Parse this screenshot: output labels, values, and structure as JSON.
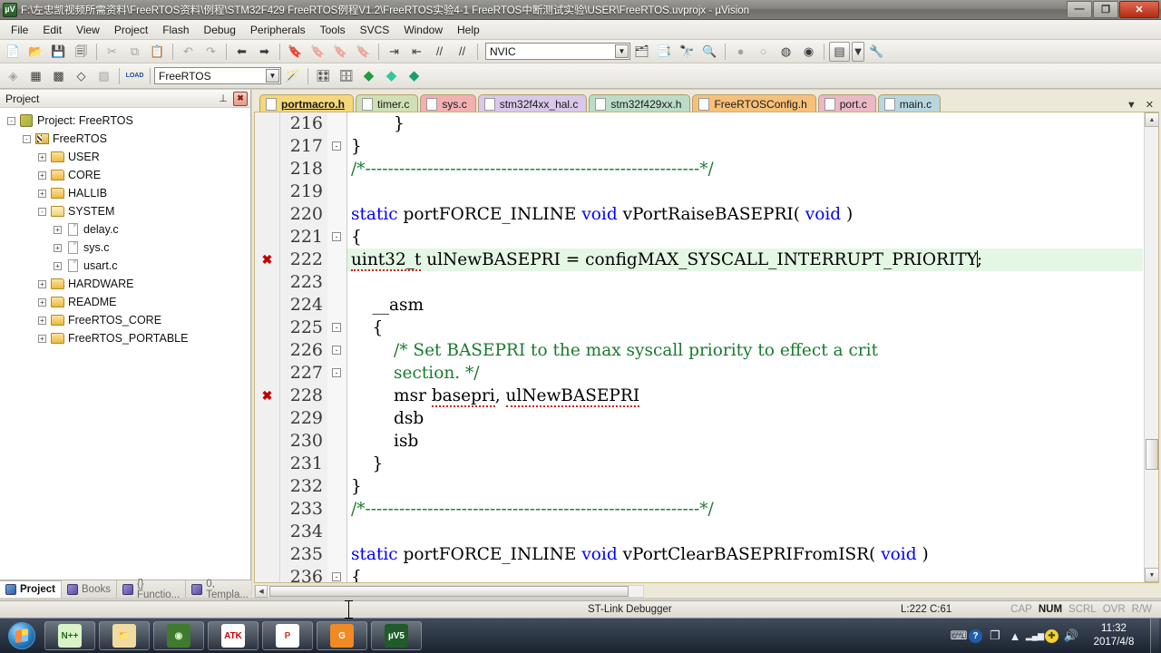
{
  "window": {
    "title": "F:\\左忠凯视频所需资料\\FreeRTOS资料\\例程\\STM32F429 FreeRTOS例程V1.2\\FreeRTOS实验4-1 FreeRTOS中断测试实验\\USER\\FreeRTOS.uvprojx - µVision",
    "app_icon_label": "µV",
    "minimize": "—",
    "restore": "❐",
    "close": "✕"
  },
  "menu": {
    "items": [
      "File",
      "Edit",
      "View",
      "Project",
      "Flash",
      "Debug",
      "Peripherals",
      "Tools",
      "SVCS",
      "Window",
      "Help"
    ]
  },
  "toolbar1": {
    "buttons": [
      {
        "name": "new-file",
        "glyph": "📄",
        "enabled": true
      },
      {
        "name": "open-file",
        "glyph": "📂",
        "enabled": true
      },
      {
        "name": "save",
        "glyph": "💾",
        "enabled": true
      },
      {
        "name": "save-all",
        "glyph": "🗐",
        "enabled": true
      },
      {
        "name": "cut",
        "glyph": "✂",
        "enabled": false
      },
      {
        "name": "copy",
        "glyph": "⧉",
        "enabled": false
      },
      {
        "name": "paste",
        "glyph": "📋",
        "enabled": true
      },
      {
        "name": "undo",
        "glyph": "↶",
        "enabled": false
      },
      {
        "name": "redo",
        "glyph": "↷",
        "enabled": false
      },
      {
        "name": "navigate-back",
        "glyph": "⬅",
        "enabled": true
      },
      {
        "name": "navigate-forward",
        "glyph": "➡",
        "enabled": true
      },
      {
        "name": "insert-bookmark",
        "glyph": "🔖",
        "enabled": true
      },
      {
        "name": "prev-bookmark",
        "glyph": "🔖",
        "enabled": false
      },
      {
        "name": "next-bookmark",
        "glyph": "🔖",
        "enabled": false
      },
      {
        "name": "clear-bookmarks",
        "glyph": "🔖",
        "enabled": false
      },
      {
        "name": "indent",
        "glyph": "⇥",
        "enabled": true
      },
      {
        "name": "outdent",
        "glyph": "⇤",
        "enabled": true
      },
      {
        "name": "comment-lines",
        "glyph": "//",
        "enabled": true
      },
      {
        "name": "uncomment-lines",
        "glyph": "//",
        "enabled": true
      }
    ],
    "symbol_combo_value": "NVIC",
    "symbol_combo_placeholder": "",
    "right_buttons": [
      {
        "name": "open-symbol",
        "glyph": "🗂",
        "enabled": true
      },
      {
        "name": "browse-info",
        "glyph": "📑",
        "enabled": true
      },
      {
        "name": "find-in-files",
        "glyph": "🔭",
        "enabled": true
      },
      {
        "name": "find-replace",
        "glyph": "🔍",
        "enabled": true
      },
      {
        "name": "insert-breakpoint",
        "glyph": "●",
        "enabled": false
      },
      {
        "name": "disable-breakpoint",
        "glyph": "○",
        "enabled": false
      },
      {
        "name": "disable-all-breakpoints",
        "glyph": "◍",
        "enabled": true
      },
      {
        "name": "kill-all-breakpoints",
        "glyph": "◉",
        "enabled": true
      },
      {
        "name": "manage-windows",
        "glyph": "▤",
        "enabled": true
      },
      {
        "name": "configuration-wizard",
        "glyph": "🔧",
        "enabled": true
      }
    ]
  },
  "toolbar2": {
    "buttons": [
      {
        "name": "translate-file",
        "glyph": "◈",
        "enabled": false
      },
      {
        "name": "build-target",
        "glyph": "▦",
        "enabled": true
      },
      {
        "name": "rebuild-all",
        "glyph": "▩",
        "enabled": true
      },
      {
        "name": "batch-build",
        "glyph": "◇",
        "enabled": true
      },
      {
        "name": "stop-build",
        "glyph": "▨",
        "enabled": false
      },
      {
        "name": "download-to-flash",
        "glyph": "LOAD",
        "enabled": true
      }
    ],
    "target_combo_value": "FreeRTOS",
    "right_buttons": [
      {
        "name": "target-options-magic-wand",
        "glyph": "🪄",
        "enabled": true
      },
      {
        "name": "options-for-target",
        "glyph": "🎛",
        "enabled": true
      },
      {
        "name": "manage-project-items",
        "glyph": "🗄",
        "enabled": true
      },
      {
        "name": "multi-project-green",
        "glyph": "◆",
        "enabled": true
      },
      {
        "name": "multi-project-teal",
        "glyph": "◆",
        "enabled": true
      },
      {
        "name": "pack-installer",
        "glyph": "◆",
        "enabled": true
      }
    ]
  },
  "project_panel": {
    "title": "Project",
    "pin_glyph": "⊥",
    "close_glyph": "✖",
    "tree": [
      {
        "depth": 0,
        "expander": "-",
        "icon": "project-root-icon",
        "label": "Project: FreeRTOS"
      },
      {
        "depth": 1,
        "expander": "-",
        "icon": "target-icon",
        "label": "FreeRTOS"
      },
      {
        "depth": 2,
        "expander": "+",
        "icon": "folder-icon",
        "label": "USER"
      },
      {
        "depth": 2,
        "expander": "+",
        "icon": "folder-icon",
        "label": "CORE"
      },
      {
        "depth": 2,
        "expander": "+",
        "icon": "folder-icon",
        "label": "HALLIB"
      },
      {
        "depth": 2,
        "expander": "-",
        "icon": "folder-open-icon",
        "label": "SYSTEM"
      },
      {
        "depth": 3,
        "expander": "+",
        "icon": "file-icon",
        "label": "delay.c"
      },
      {
        "depth": 3,
        "expander": "+",
        "icon": "file-icon",
        "label": "sys.c"
      },
      {
        "depth": 3,
        "expander": "+",
        "icon": "file-icon",
        "label": "usart.c"
      },
      {
        "depth": 2,
        "expander": "+",
        "icon": "folder-icon",
        "label": "HARDWARE"
      },
      {
        "depth": 2,
        "expander": "+",
        "icon": "folder-icon",
        "label": "README"
      },
      {
        "depth": 2,
        "expander": "+",
        "icon": "folder-icon",
        "label": "FreeRTOS_CORE"
      },
      {
        "depth": 2,
        "expander": "+",
        "icon": "folder-icon",
        "label": "FreeRTOS_PORTABLE"
      }
    ],
    "bottom_tabs": [
      {
        "label": "Project",
        "icon": "project-tab-icon",
        "active": true
      },
      {
        "label": "Books",
        "icon": "books-tab-icon",
        "active": false
      },
      {
        "label": "{} Functio...",
        "icon": "functions-tab-icon",
        "active": false
      },
      {
        "label": "0, Templa...",
        "icon": "templates-tab-icon",
        "active": false
      }
    ]
  },
  "editor": {
    "tabs": [
      {
        "label": "portmacro.h",
        "color": "#f6d87a",
        "active": true
      },
      {
        "label": "timer.c",
        "color": "#cfe0b4",
        "active": false
      },
      {
        "label": "sys.c",
        "color": "#f2b0b0",
        "active": false
      },
      {
        "label": "stm32f4xx_hal.c",
        "color": "#d9c8ea",
        "active": false
      },
      {
        "label": "stm32f429xx.h",
        "color": "#bcdcc8",
        "active": false
      },
      {
        "label": "FreeRTOSConfig.h",
        "color": "#f7c079",
        "active": false
      },
      {
        "label": "port.c",
        "color": "#eab8c6",
        "active": false
      },
      {
        "label": "main.c",
        "color": "#b9d6de",
        "active": false
      }
    ],
    "tab_dropdown_glyph": "▼",
    "tab_close_glyph": "✕",
    "lines": [
      {
        "num": "216",
        "fold": "",
        "mark": "",
        "highlight": false,
        "segments": [
          {
            "t": "        }",
            "c": "plain"
          }
        ]
      },
      {
        "num": "217",
        "fold": "-",
        "mark": "",
        "highlight": false,
        "segments": [
          {
            "t": "}",
            "c": "plain"
          }
        ]
      },
      {
        "num": "218",
        "fold": "",
        "mark": "",
        "highlight": false,
        "segments": [
          {
            "t": "/*-----------------------------------------------------------*/",
            "c": "cmt"
          }
        ]
      },
      {
        "num": "219",
        "fold": "",
        "mark": "",
        "highlight": false,
        "segments": []
      },
      {
        "num": "220",
        "fold": "",
        "mark": "",
        "highlight": false,
        "segments": [
          {
            "t": "static",
            "c": "kw"
          },
          {
            "t": " portFORCE_INLINE ",
            "c": "plain"
          },
          {
            "t": "void",
            "c": "kw"
          },
          {
            "t": " vPortRaiseBASEPRI( ",
            "c": "plain"
          },
          {
            "t": "void",
            "c": "kw"
          },
          {
            "t": " )",
            "c": "plain"
          }
        ]
      },
      {
        "num": "221",
        "fold": "-",
        "mark": "",
        "highlight": false,
        "segments": [
          {
            "t": "{",
            "c": "plain"
          }
        ]
      },
      {
        "num": "222",
        "fold": "",
        "mark": "✖",
        "highlight": true,
        "segments": [
          {
            "t": "uint32_t",
            "c": "squiggle"
          },
          {
            "t": " ulNewBASEPRI = configMAX_SYSCALL_INTERRUPT_PRIORITY",
            "c": "plain"
          },
          {
            "t": "|",
            "c": "caret"
          },
          {
            "t": ";",
            "c": "plain"
          }
        ]
      },
      {
        "num": "223",
        "fold": "",
        "mark": "",
        "highlight": false,
        "segments": []
      },
      {
        "num": "224",
        "fold": "",
        "mark": "",
        "highlight": false,
        "segments": [
          {
            "t": "    __asm",
            "c": "plain"
          }
        ]
      },
      {
        "num": "225",
        "fold": "-",
        "mark": "",
        "highlight": false,
        "segments": [
          {
            "t": "    {",
            "c": "plain"
          }
        ]
      },
      {
        "num": "226",
        "fold": "-",
        "mark": "",
        "highlight": false,
        "segments": [
          {
            "t": "        /* Set BASEPRI to the max syscall priority to effect a crit",
            "c": "cmt"
          }
        ]
      },
      {
        "num": "227",
        "fold": "-",
        "mark": "",
        "highlight": false,
        "segments": [
          {
            "t": "        section. */",
            "c": "cmt"
          }
        ]
      },
      {
        "num": "228",
        "fold": "",
        "mark": "✖",
        "highlight": false,
        "segments": [
          {
            "t": "        msr ",
            "c": "plain"
          },
          {
            "t": "basepri",
            "c": "squiggle"
          },
          {
            "t": ", ",
            "c": "plain"
          },
          {
            "t": "ulNewBASEPRI",
            "c": "squiggle"
          }
        ]
      },
      {
        "num": "229",
        "fold": "",
        "mark": "",
        "highlight": false,
        "segments": [
          {
            "t": "        dsb",
            "c": "plain"
          }
        ]
      },
      {
        "num": "230",
        "fold": "",
        "mark": "",
        "highlight": false,
        "segments": [
          {
            "t": "        isb",
            "c": "plain"
          }
        ]
      },
      {
        "num": "231",
        "fold": "",
        "mark": "",
        "highlight": false,
        "segments": [
          {
            "t": "    }",
            "c": "plain"
          }
        ]
      },
      {
        "num": "232",
        "fold": "",
        "mark": "",
        "highlight": false,
        "segments": [
          {
            "t": "}",
            "c": "plain"
          }
        ]
      },
      {
        "num": "233",
        "fold": "",
        "mark": "",
        "highlight": false,
        "segments": [
          {
            "t": "/*-----------------------------------------------------------*/",
            "c": "cmt"
          }
        ]
      },
      {
        "num": "234",
        "fold": "",
        "mark": "",
        "highlight": false,
        "segments": []
      },
      {
        "num": "235",
        "fold": "",
        "mark": "",
        "highlight": false,
        "segments": [
          {
            "t": "static",
            "c": "kw"
          },
          {
            "t": " portFORCE_INLINE ",
            "c": "plain"
          },
          {
            "t": "void",
            "c": "kw"
          },
          {
            "t": " vPortClearBASEPRIFromISR( ",
            "c": "plain"
          },
          {
            "t": "void",
            "c": "kw"
          },
          {
            "t": " )",
            "c": "plain"
          }
        ]
      },
      {
        "num": "236",
        "fold": "-",
        "mark": "",
        "highlight": false,
        "segments": [
          {
            "t": "{",
            "c": "plain"
          }
        ]
      }
    ],
    "scroll_up_glyph": "▲",
    "scroll_down_glyph": "▼",
    "scroll_left_glyph": "◀",
    "scroll_right_glyph": "▶"
  },
  "statusbar": {
    "debugger": "ST-Link Debugger",
    "cursor": "L:222 C:61",
    "indicators": [
      {
        "label": "CAP",
        "active": false
      },
      {
        "label": "NUM",
        "active": true
      },
      {
        "label": "SCRL",
        "active": false
      },
      {
        "label": "OVR",
        "active": false
      },
      {
        "label": "R/W",
        "active": false
      }
    ]
  },
  "taskbar": {
    "start_label": "Start",
    "apps": [
      {
        "name": "notepadpp",
        "label": "N++",
        "color": "#d9f2c8",
        "text_color": "#1b6b1b"
      },
      {
        "name": "file-explorer",
        "label": "📁",
        "color": "#f0dca0",
        "text_color": "#8a6a10"
      },
      {
        "name": "unknown-green",
        "label": "◉",
        "color": "#3f7a2f",
        "text_color": "#d9f5c4"
      },
      {
        "name": "atk-xcom",
        "label": "ATK",
        "color": "#ffffff",
        "text_color": "#cc0000"
      },
      {
        "name": "powerpoint",
        "label": "P",
        "color": "#ffffff",
        "text_color": "#c43e1c"
      },
      {
        "name": "pdf-converter",
        "label": "G",
        "color": "#f08a24",
        "text_color": "#ffffff"
      },
      {
        "name": "keil-uvision",
        "label": "µV5",
        "color": "#1f5c2a",
        "text_color": "#ffffff"
      }
    ],
    "tray_icons": [
      {
        "name": "keyboard-layout-icon",
        "glyph": "⌨"
      },
      {
        "name": "help-icon",
        "glyph": "?"
      },
      {
        "name": "window-switch-icon",
        "glyph": "❐"
      },
      {
        "name": "show-hidden-icons-icon",
        "glyph": "▲"
      },
      {
        "name": "network-icon",
        "glyph": "▂▄▆"
      },
      {
        "name": "action-center-icon",
        "glyph": "✚"
      },
      {
        "name": "volume-icon",
        "glyph": "🔊"
      }
    ],
    "clock_time": "11:32",
    "clock_date": "2017/4/8"
  }
}
